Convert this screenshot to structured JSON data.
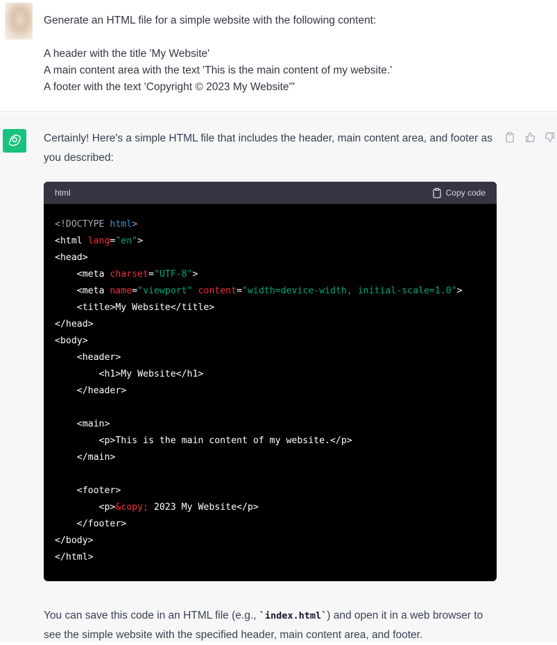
{
  "user_message": {
    "lines": [
      "Generate an HTML file for a simple website with the following content:",
      "",
      "A header with the title 'My Website'",
      "A main content area with the text 'This is the main content of my website.'",
      "A footer with the text 'Copyright © 2023 My Website'\""
    ]
  },
  "assistant": {
    "intro": "Certainly! Here's a simple HTML file that includes the header, main content area, and footer as you described:",
    "actions": [
      "clipboard-icon",
      "thumbs-up-icon",
      "thumbs-down-icon"
    ],
    "code_block": {
      "language": "html",
      "copy_label": "Copy code",
      "lines": [
        "<!DOCTYPE html>",
        "<html lang=\"en\">",
        "<head>",
        "    <meta charset=\"UTF-8\">",
        "    <meta name=\"viewport\" content=\"width=device-width, initial-scale=1.0\">",
        "    <title>My Website</title>",
        "</head>",
        "<body>",
        "    <header>",
        "        <h1>My Website</h1>",
        "    </header>",
        "",
        "    <main>",
        "        <p>This is the main content of my website.</p>",
        "    </main>",
        "",
        "    <footer>",
        "        <p>&copy; 2023 My Website</p>",
        "    </footer>",
        "</body>",
        "</html>"
      ]
    },
    "outro_before_code": "You can save this code in an HTML file (e.g., ",
    "outro_code": "`index.html`",
    "outro_after_code": ") and open it in a web browser to see the simple website with the specified header, main content area, and footer."
  },
  "colors": {
    "assistant_bg": "#f7f7f8",
    "gpt_green": "#19c37d",
    "code_bg": "#000000",
    "code_header_bg": "#343541"
  }
}
